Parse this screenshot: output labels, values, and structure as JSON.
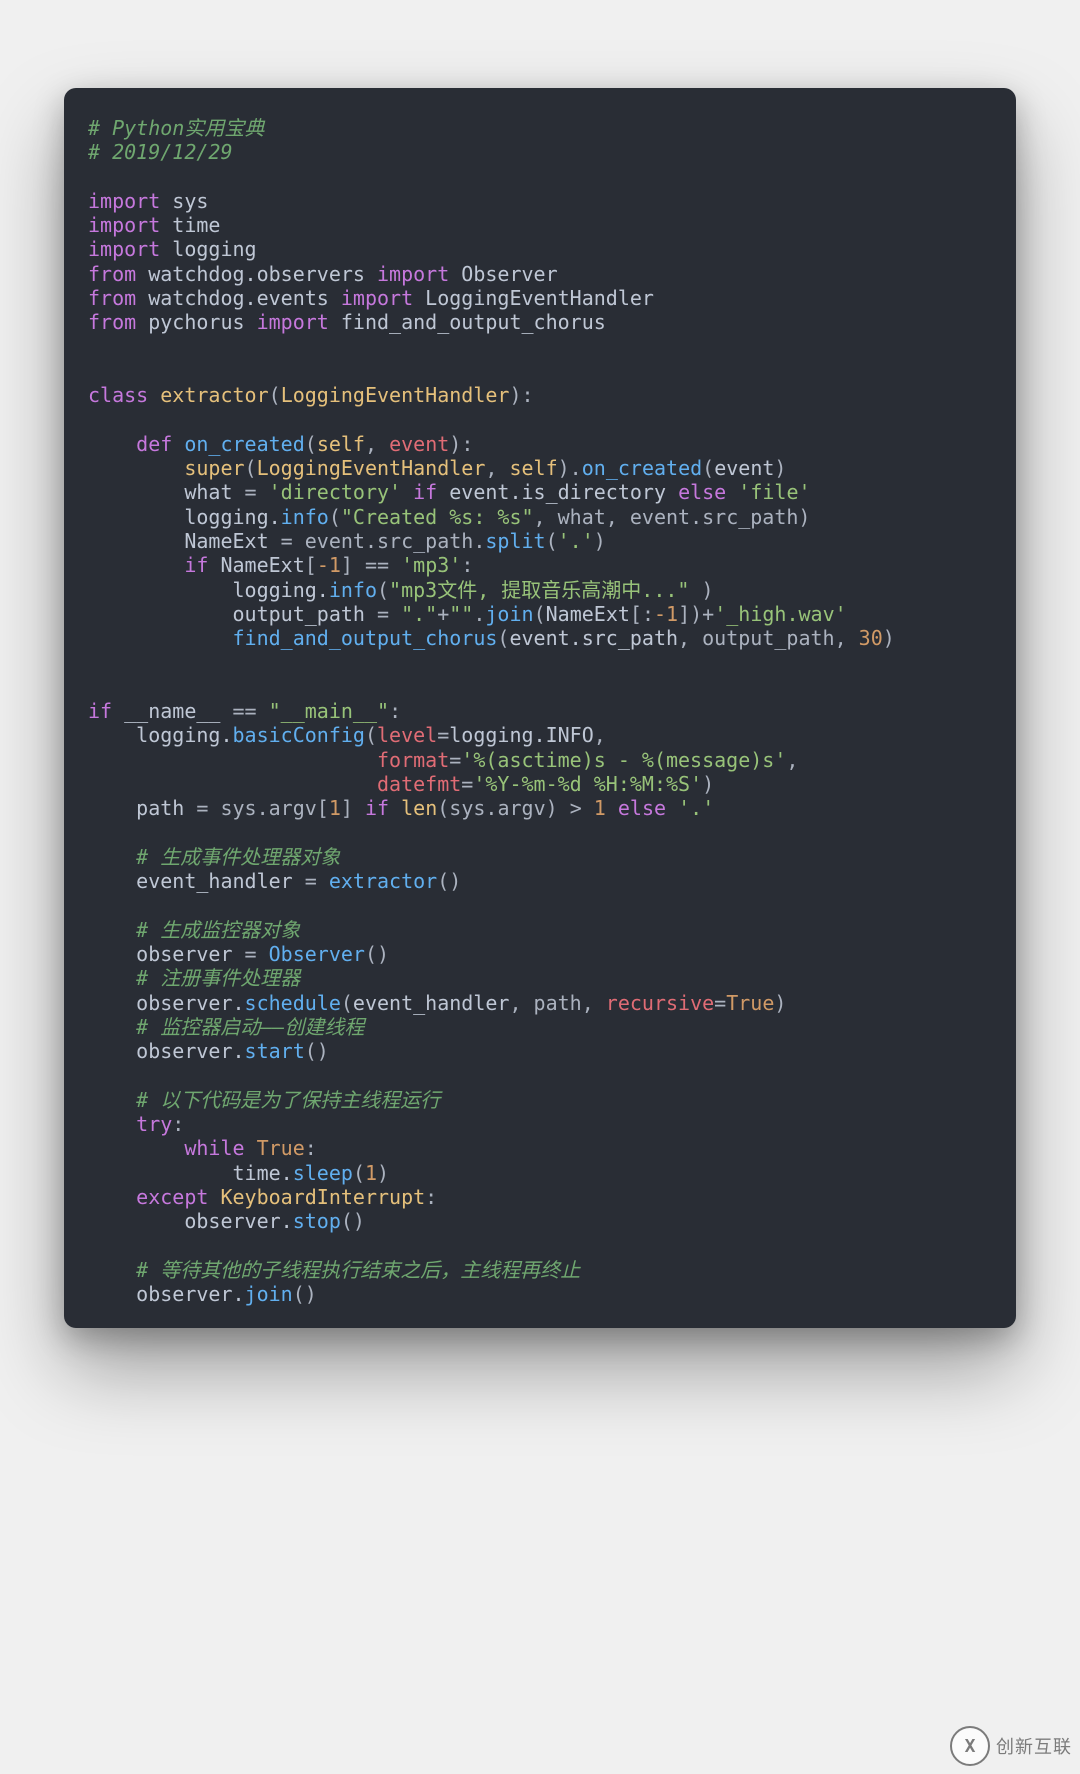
{
  "code": {
    "tokens": [
      [
        [
          "c-comment",
          "# Python实用宝典"
        ]
      ],
      [
        [
          "c-comment",
          "# 2019/12/29"
        ]
      ],
      [],
      [
        [
          "c-kw",
          "import"
        ],
        [
          "c-op",
          " "
        ],
        [
          "c-mod",
          "sys"
        ]
      ],
      [
        [
          "c-kw",
          "import"
        ],
        [
          "c-op",
          " "
        ],
        [
          "c-mod",
          "time"
        ]
      ],
      [
        [
          "c-kw",
          "import"
        ],
        [
          "c-op",
          " "
        ],
        [
          "c-mod",
          "logging"
        ]
      ],
      [
        [
          "c-kw",
          "from"
        ],
        [
          "c-op",
          " "
        ],
        [
          "c-mod",
          "watchdog.observers "
        ],
        [
          "c-kw",
          "import"
        ],
        [
          "c-op",
          " "
        ],
        [
          "c-mod",
          "Observer"
        ]
      ],
      [
        [
          "c-kw",
          "from"
        ],
        [
          "c-op",
          " "
        ],
        [
          "c-mod",
          "watchdog.events "
        ],
        [
          "c-kw",
          "import"
        ],
        [
          "c-op",
          " "
        ],
        [
          "c-mod",
          "LoggingEventHandler"
        ]
      ],
      [
        [
          "c-kw",
          "from"
        ],
        [
          "c-op",
          " "
        ],
        [
          "c-mod",
          "pychorus "
        ],
        [
          "c-kw",
          "import"
        ],
        [
          "c-op",
          " "
        ],
        [
          "c-mod",
          "find_and_output_chorus"
        ]
      ],
      [],
      [],
      [
        [
          "c-kw",
          "class"
        ],
        [
          "c-op",
          " "
        ],
        [
          "c-cls",
          "extractor"
        ],
        [
          "c-op",
          "("
        ],
        [
          "c-cls",
          "LoggingEventHandler"
        ],
        [
          "c-op",
          "):"
        ]
      ],
      [],
      [
        [
          "c-op",
          "    "
        ],
        [
          "c-def",
          "def"
        ],
        [
          "c-op",
          " "
        ],
        [
          "c-fn",
          "on_created"
        ],
        [
          "c-op",
          "("
        ],
        [
          "c-self",
          "self"
        ],
        [
          "c-op",
          ", "
        ],
        [
          "c-param",
          "event"
        ],
        [
          "c-op",
          "):"
        ]
      ],
      [
        [
          "c-op",
          "        "
        ],
        [
          "c-builtin",
          "super"
        ],
        [
          "c-op",
          "("
        ],
        [
          "c-cls",
          "LoggingEventHandler"
        ],
        [
          "c-op",
          ", "
        ],
        [
          "c-self",
          "self"
        ],
        [
          "c-op",
          ")."
        ],
        [
          "c-fn",
          "on_created"
        ],
        [
          "c-op",
          "("
        ],
        [
          "c-name",
          "event"
        ],
        [
          "c-op",
          ")"
        ]
      ],
      [
        [
          "c-op",
          "        "
        ],
        [
          "c-name",
          "what"
        ],
        [
          "c-op",
          " = "
        ],
        [
          "c-str",
          "'directory'"
        ],
        [
          "c-op",
          " "
        ],
        [
          "c-kw",
          "if"
        ],
        [
          "c-op",
          " "
        ],
        [
          "c-name",
          "event.is_directory"
        ],
        [
          "c-op",
          " "
        ],
        [
          "c-kw",
          "else"
        ],
        [
          "c-op",
          " "
        ],
        [
          "c-str",
          "'file'"
        ]
      ],
      [
        [
          "c-op",
          "        "
        ],
        [
          "c-name",
          "logging."
        ],
        [
          "c-fn",
          "info"
        ],
        [
          "c-op",
          "("
        ],
        [
          "c-str",
          "\"Created %s: %s\""
        ],
        [
          "c-op",
          ", what, event.src_path)"
        ]
      ],
      [
        [
          "c-op",
          "        "
        ],
        [
          "c-name",
          "NameExt"
        ],
        [
          "c-op",
          " = event.src_path."
        ],
        [
          "c-fn",
          "split"
        ],
        [
          "c-op",
          "("
        ],
        [
          "c-str",
          "'.'"
        ],
        [
          "c-op",
          ")"
        ]
      ],
      [
        [
          "c-op",
          "        "
        ],
        [
          "c-kw",
          "if"
        ],
        [
          "c-op",
          " "
        ],
        [
          "c-name",
          "NameExt"
        ],
        [
          "c-op",
          "["
        ],
        [
          "c-num",
          "-1"
        ],
        [
          "c-op",
          "] == "
        ],
        [
          "c-str",
          "'mp3'"
        ],
        [
          "c-op",
          ":"
        ]
      ],
      [
        [
          "c-op",
          "            "
        ],
        [
          "c-name",
          "logging."
        ],
        [
          "c-fn",
          "info"
        ],
        [
          "c-op",
          "("
        ],
        [
          "c-str",
          "\"mp3文件, 提取音乐高潮中...\""
        ],
        [
          "c-op",
          " )"
        ]
      ],
      [
        [
          "c-op",
          "            "
        ],
        [
          "c-name",
          "output_path"
        ],
        [
          "c-op",
          " = "
        ],
        [
          "c-str",
          "\".\""
        ],
        [
          "c-op",
          "+"
        ],
        [
          "c-str",
          "\"\""
        ],
        [
          "c-op",
          "."
        ],
        [
          "c-fn",
          "join"
        ],
        [
          "c-op",
          "("
        ],
        [
          "c-name",
          "NameExt"
        ],
        [
          "c-op",
          "[:"
        ],
        [
          "c-num",
          "-1"
        ],
        [
          "c-op",
          "])+"
        ],
        [
          "c-str",
          "'_high.wav'"
        ]
      ],
      [
        [
          "c-op",
          "            "
        ],
        [
          "c-fn",
          "find_and_output_chorus"
        ],
        [
          "c-op",
          "("
        ],
        [
          "c-name",
          "event.src_path"
        ],
        [
          "c-op",
          ", output_path, "
        ],
        [
          "c-num",
          "30"
        ],
        [
          "c-op",
          ")"
        ]
      ],
      [],
      [],
      [
        [
          "c-kw",
          "if"
        ],
        [
          "c-op",
          " "
        ],
        [
          "c-name",
          "__name__"
        ],
        [
          "c-op",
          " == "
        ],
        [
          "c-str",
          "\"__main__\""
        ],
        [
          "c-op",
          ":"
        ]
      ],
      [
        [
          "c-op",
          "    "
        ],
        [
          "c-name",
          "logging."
        ],
        [
          "c-fn",
          "basicConfig"
        ],
        [
          "c-op",
          "("
        ],
        [
          "c-param",
          "level"
        ],
        [
          "c-op",
          "="
        ],
        [
          "c-name",
          "logging.INFO"
        ],
        [
          "c-op",
          ","
        ]
      ],
      [
        [
          "c-op",
          "                        "
        ],
        [
          "c-param",
          "format"
        ],
        [
          "c-op",
          "="
        ],
        [
          "c-str",
          "'%(asctime)s - %(message)s'"
        ],
        [
          "c-op",
          ","
        ]
      ],
      [
        [
          "c-op",
          "                        "
        ],
        [
          "c-param",
          "datefmt"
        ],
        [
          "c-op",
          "="
        ],
        [
          "c-str",
          "'%Y-%m-%d %H:%M:%S'"
        ],
        [
          "c-op",
          ")"
        ]
      ],
      [
        [
          "c-op",
          "    "
        ],
        [
          "c-name",
          "path"
        ],
        [
          "c-op",
          " = sys.argv["
        ],
        [
          "c-num",
          "1"
        ],
        [
          "c-op",
          "] "
        ],
        [
          "c-kw",
          "if"
        ],
        [
          "c-op",
          " "
        ],
        [
          "c-builtin",
          "len"
        ],
        [
          "c-op",
          "(sys.argv) > "
        ],
        [
          "c-num",
          "1"
        ],
        [
          "c-op",
          " "
        ],
        [
          "c-kw",
          "else"
        ],
        [
          "c-op",
          " "
        ],
        [
          "c-str",
          "'.'"
        ]
      ],
      [],
      [
        [
          "c-op",
          "    "
        ],
        [
          "c-comment",
          "# 生成事件处理器对象"
        ]
      ],
      [
        [
          "c-op",
          "    "
        ],
        [
          "c-name",
          "event_handler"
        ],
        [
          "c-op",
          " = "
        ],
        [
          "c-fn",
          "extractor"
        ],
        [
          "c-op",
          "()"
        ]
      ],
      [],
      [
        [
          "c-op",
          "    "
        ],
        [
          "c-comment",
          "# 生成监控器对象"
        ]
      ],
      [
        [
          "c-op",
          "    "
        ],
        [
          "c-name",
          "observer"
        ],
        [
          "c-op",
          " = "
        ],
        [
          "c-fn",
          "Observer"
        ],
        [
          "c-op",
          "()"
        ]
      ],
      [
        [
          "c-op",
          "    "
        ],
        [
          "c-comment",
          "# 注册事件处理器"
        ]
      ],
      [
        [
          "c-op",
          "    "
        ],
        [
          "c-name",
          "observer."
        ],
        [
          "c-fn",
          "schedule"
        ],
        [
          "c-op",
          "("
        ],
        [
          "c-name",
          "event_handler"
        ],
        [
          "c-op",
          ", path, "
        ],
        [
          "c-param",
          "recursive"
        ],
        [
          "c-op",
          "="
        ],
        [
          "c-const",
          "True"
        ],
        [
          "c-op",
          ")"
        ]
      ],
      [
        [
          "c-op",
          "    "
        ],
        [
          "c-comment",
          "# 监控器启动——创建线程"
        ]
      ],
      [
        [
          "c-op",
          "    "
        ],
        [
          "c-name",
          "observer."
        ],
        [
          "c-fn",
          "start"
        ],
        [
          "c-op",
          "()"
        ]
      ],
      [],
      [
        [
          "c-op",
          "    "
        ],
        [
          "c-comment",
          "# 以下代码是为了保持主线程运行"
        ]
      ],
      [
        [
          "c-op",
          "    "
        ],
        [
          "c-kw",
          "try"
        ],
        [
          "c-op",
          ":"
        ]
      ],
      [
        [
          "c-op",
          "        "
        ],
        [
          "c-kw",
          "while"
        ],
        [
          "c-op",
          " "
        ],
        [
          "c-const",
          "True"
        ],
        [
          "c-op",
          ":"
        ]
      ],
      [
        [
          "c-op",
          "            "
        ],
        [
          "c-name",
          "time."
        ],
        [
          "c-fn",
          "sleep"
        ],
        [
          "c-op",
          "("
        ],
        [
          "c-num",
          "1"
        ],
        [
          "c-op",
          ")"
        ]
      ],
      [
        [
          "c-op",
          "    "
        ],
        [
          "c-kw",
          "except"
        ],
        [
          "c-op",
          " "
        ],
        [
          "c-cls",
          "KeyboardInterrupt"
        ],
        [
          "c-op",
          ":"
        ]
      ],
      [
        [
          "c-op",
          "        "
        ],
        [
          "c-name",
          "observer."
        ],
        [
          "c-fn",
          "stop"
        ],
        [
          "c-op",
          "()"
        ]
      ],
      [],
      [
        [
          "c-op",
          "    "
        ],
        [
          "c-comment",
          "# 等待其他的子线程执行结束之后，主线程再终止"
        ]
      ],
      [
        [
          "c-op",
          "    "
        ],
        [
          "c-name",
          "observer."
        ],
        [
          "c-fn",
          "join"
        ],
        [
          "c-op",
          "()"
        ]
      ]
    ]
  },
  "watermark": {
    "logo_letter": "X",
    "text": "创新互联"
  }
}
